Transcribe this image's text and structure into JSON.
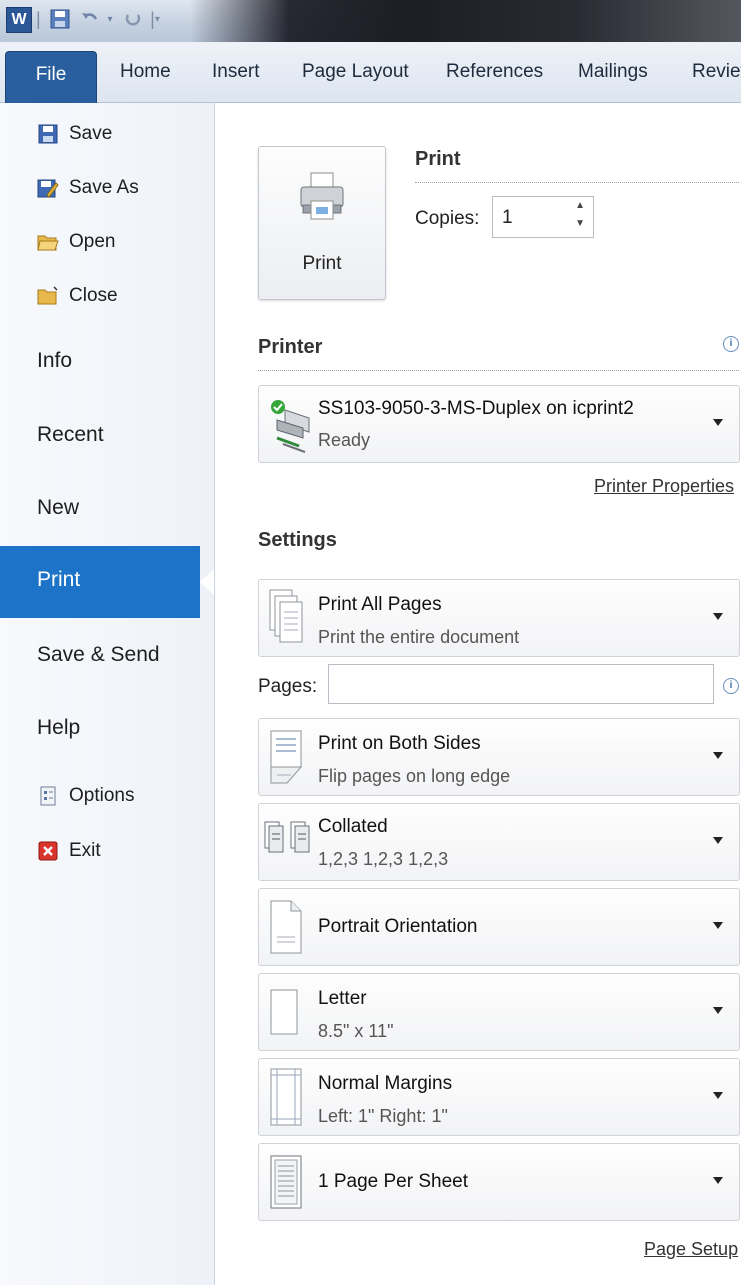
{
  "titlebar": {
    "app_icon_letter": "W"
  },
  "tabs": [
    {
      "label": "File"
    },
    {
      "label": "Home"
    },
    {
      "label": "Insert"
    },
    {
      "label": "Page Layout"
    },
    {
      "label": "References"
    },
    {
      "label": "Mailings"
    },
    {
      "label": "Review"
    }
  ],
  "nav": {
    "save": "Save",
    "save_as": "Save As",
    "open": "Open",
    "close": "Close",
    "info": "Info",
    "recent": "Recent",
    "new": "New",
    "print": "Print",
    "save_send": "Save & Send",
    "help": "Help",
    "options": "Options",
    "exit": "Exit"
  },
  "print": {
    "section_title": "Print",
    "button_label": "Print",
    "copies_label": "Copies:",
    "copies_value": "1"
  },
  "printer": {
    "section_title": "Printer",
    "name": "SS103-9050-3-MS-Duplex on icprint2",
    "status": "Ready",
    "properties_link": "Printer Properties"
  },
  "settings": {
    "section_title": "Settings",
    "pages_label": "Pages:",
    "pages_value": "",
    "items": [
      {
        "main": "Print All Pages",
        "sub": "Print the entire document"
      },
      {
        "main": "Print on Both Sides",
        "sub": "Flip pages on long edge"
      },
      {
        "main": "Collated",
        "sub": "1,2,3    1,2,3    1,2,3"
      },
      {
        "main": "Portrait Orientation",
        "sub": ""
      },
      {
        "main": "Letter",
        "sub": "8.5\" x 11\""
      },
      {
        "main": "Normal Margins",
        "sub": "Left: 1\"    Right: 1\""
      },
      {
        "main": "1 Page Per Sheet",
        "sub": ""
      }
    ],
    "page_setup_link": "Page Setup"
  },
  "colors": {
    "accent": "#1c73c7",
    "file_tab": "#2a5f9f"
  }
}
